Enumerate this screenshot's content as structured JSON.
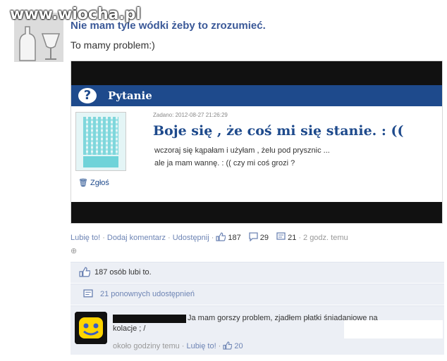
{
  "watermark": "www.wiocha.pl",
  "post": {
    "title": "Nie mam tyle wódki żeby to zrozumieć.",
    "text": "To mamy problem:)"
  },
  "shared": {
    "header_label": "Pytanie",
    "date": "Zadano: 2012-08-27 21:26:29",
    "question": "Boje się , że coś mi się stanie. : ((",
    "body_line1": "wczoraj się kąpałam i użyłam , żelu pod prysznic ...",
    "body_line2": "ale ja mam wannę. : (( czy mi coś grozi ?",
    "trash_label": "Zgłoś"
  },
  "actions": {
    "like": "Lubię to!",
    "comment": "Dodaj komentarz",
    "share": "Udostępnij",
    "likes_count": "187",
    "comments_count": "29",
    "shares_count": "21",
    "time": "2 godz. temu"
  },
  "likes_row": {
    "text": "187 osób lubi to."
  },
  "shares_row": {
    "text": "21 ponownych udostępnień"
  },
  "comment": {
    "text": "Ja mam gorszy problem, zjadłem płatki śniadaniowe na kolacje ; /",
    "time": "około godziny temu",
    "like": "Lubię to!",
    "likes": "20"
  },
  "colors": {
    "fb_blue": "#3b5998",
    "link": "#6d84b4",
    "header_blue": "#1e4a8c",
    "panel": "#eceff5"
  }
}
